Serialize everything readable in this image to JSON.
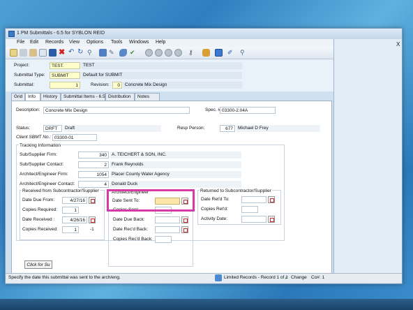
{
  "window": {
    "title": "1 PM Submittals - 6.5 for SYBLON REID"
  },
  "menu": [
    "File",
    "Edit",
    "Records",
    "View",
    "Options",
    "Tools",
    "Windows",
    "Help"
  ],
  "right_panel": {
    "close_label": "X"
  },
  "header": {
    "project_label": "Project:",
    "project_code": "TEST.",
    "project_name": "TEST",
    "type_label": "Submittal Type:",
    "type_code": "SUBMIT",
    "type_desc": "Default for SUBMIT",
    "submittal_label": "Submittal:",
    "submittal_value": "1",
    "revision_label": "Revision:",
    "revision_value": "0",
    "revision_desc": "Concrete Mix Design"
  },
  "tabs": [
    "Grid",
    "Info",
    "History",
    "Submittal Items - 6.5",
    "Distribution",
    "Notes"
  ],
  "info": {
    "description_label": "Description:",
    "description_value": "Concrete Mix Design",
    "spec_label": "Spec. #:",
    "spec_value": "03300-2.04A",
    "status_label": "Status:",
    "status_code": "DRFT",
    "status_desc": "Draft",
    "resp_label": "Resp Person:",
    "resp_id": "677",
    "resp_name": "Michael D Frey",
    "client_label": "Client SBMT No.:",
    "client_value": "03300-01"
  },
  "tracking": {
    "title": "Tracking Information",
    "sub_firm_label": "Sub/Supplier Firm:",
    "sub_firm_id": "340",
    "sub_firm_name": "A. TEICHERT & SON, INC.",
    "sub_contact_label": "Sub/Supplier Contact:",
    "sub_contact_id": "2",
    "sub_contact_name": "Frank   Reynolds",
    "arch_firm_label": "Architect/Engineer Firm:",
    "arch_firm_id": "1054",
    "arch_firm_name": "Placer County Water Agency",
    "arch_contact_label": "Architect/Engineer Contact:",
    "arch_contact_id": "4",
    "arch_contact_name": "Donald   Duck"
  },
  "received": {
    "title": "Received from Subcontractor/Supplier",
    "due_label": "Date Due From:",
    "due_value": "4/27/16",
    "copies_req_label": "Copies Required:",
    "copies_req_value": "1",
    "date_recv_label": "Date Received :",
    "date_recv_value": "4/26/16",
    "copies_recv_label": "Copies Received:",
    "copies_recv_value": "1",
    "copies_recv_diff": "-1"
  },
  "architect": {
    "title": "Architect/Engineer",
    "sent_label": "Date Sent To:",
    "copies_sent_label": "Copies Sent:",
    "due_back_label": "Date Due Back:",
    "recd_back_label": "Date Rec'd Back:",
    "copies_recd_back_label": "Copies Rec'd Back:"
  },
  "returned": {
    "title": "Returned to Subcontractor/Supplier",
    "date_retd_label": "Date Ret'd To:",
    "copies_retd_label": "Copies Ret'd:",
    "activity_label": "Activity Date:"
  },
  "click_button": "Click for Su",
  "status": {
    "message": "Specify the date this submittal was sent to the arch/eng.",
    "records": "Limited Records - Record 1 of 1",
    "mode": "Change",
    "company": "Co#: 1"
  }
}
